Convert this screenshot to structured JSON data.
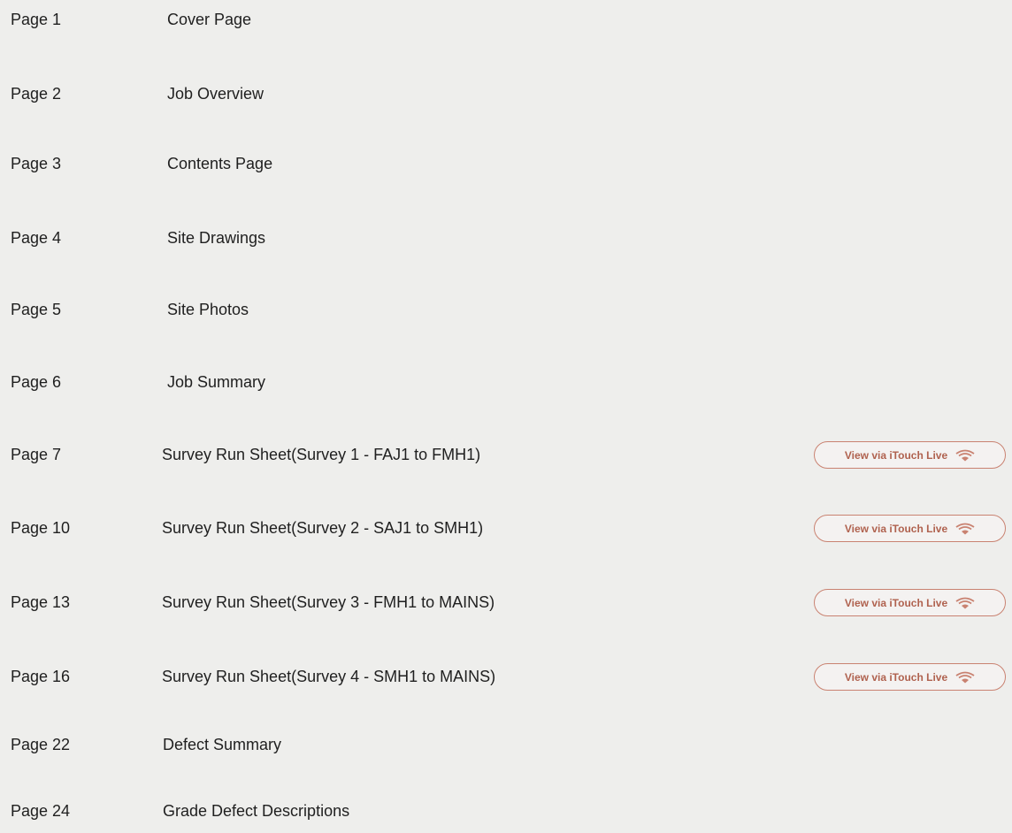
{
  "toc": {
    "entries": [
      {
        "page": "Page 1",
        "title": "Cover Page"
      },
      {
        "page": "Page 2",
        "title": "Job Overview"
      },
      {
        "page": "Page 3",
        "title": "Contents Page"
      },
      {
        "page": "Page 4",
        "title": "Site Drawings"
      },
      {
        "page": "Page 5",
        "title": "Site Photos"
      },
      {
        "page": "Page 6",
        "title": "Job Summary"
      },
      {
        "page": "Page 7",
        "title": "Survey Run Sheet(Survey 1 - FAJ1 to FMH1)",
        "live_label": "View via iTouch Live"
      },
      {
        "page": "Page 10",
        "title": "Survey Run Sheet(Survey 2 - SAJ1 to SMH1)",
        "live_label": "View via iTouch Live"
      },
      {
        "page": "Page 13",
        "title": "Survey Run Sheet(Survey 3 - FMH1 to MAINS)",
        "live_label": "View via iTouch Live"
      },
      {
        "page": "Page 16",
        "title": "Survey Run Sheet(Survey 4 - SMH1 to MAINS)",
        "live_label": "View via iTouch Live"
      },
      {
        "page": "Page 22",
        "title": "Defect Summary"
      },
      {
        "page": "Page 24",
        "title": "Grade Defect Descriptions"
      }
    ]
  },
  "colors": {
    "background": "#eeeeec",
    "text": "#1f1f1f",
    "button_border": "#c98271",
    "button_text": "#b0624f"
  },
  "icons": {
    "live_button_icon": "wifi-signal-icon"
  }
}
